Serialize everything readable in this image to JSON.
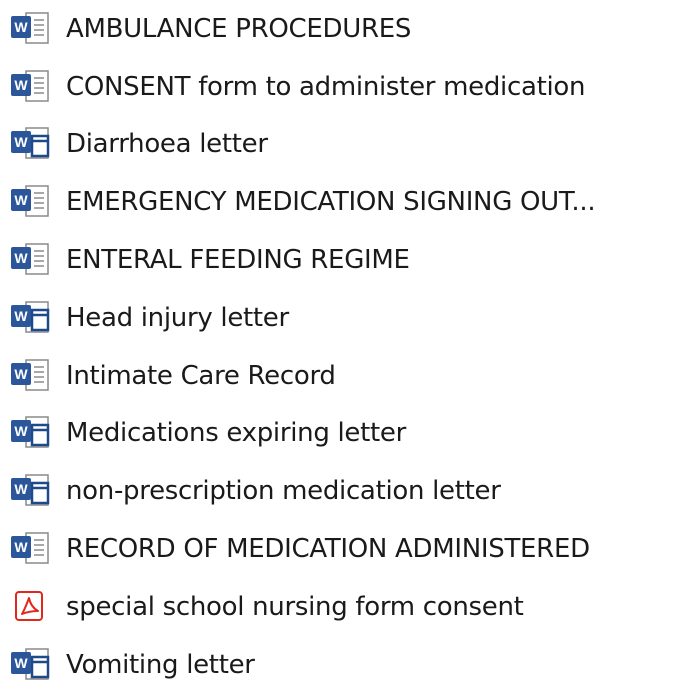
{
  "files": [
    {
      "name": "AMBULANCE PROCEDURES",
      "icon": "word-document-icon"
    },
    {
      "name": "CONSENT form to administer medication",
      "icon": "word-document-icon"
    },
    {
      "name": "Diarrhoea letter",
      "icon": "word-template-icon"
    },
    {
      "name": "EMERGENCY MEDICATION SIGNING OUT...",
      "icon": "word-document-icon"
    },
    {
      "name": "ENTERAL FEEDING REGIME",
      "icon": "word-document-icon"
    },
    {
      "name": "Head injury letter",
      "icon": "word-template-icon"
    },
    {
      "name": "Intimate Care Record",
      "icon": "word-document-icon"
    },
    {
      "name": "Medications expiring letter",
      "icon": "word-template-icon"
    },
    {
      "name": "non-prescription medication letter",
      "icon": "word-template-icon"
    },
    {
      "name": "RECORD OF MEDICATION ADMINISTERED",
      "icon": "word-document-icon"
    },
    {
      "name": "special school nursing form consent",
      "icon": "pdf-document-icon"
    },
    {
      "name": "Vomiting letter",
      "icon": "word-template-icon"
    }
  ],
  "colors": {
    "word_blue": "#2b579a",
    "word_blue_dark": "#1e4a8a",
    "pdf_red": "#e0281c",
    "page_border": "#8a8a8a",
    "text": "#1a1a1a"
  }
}
